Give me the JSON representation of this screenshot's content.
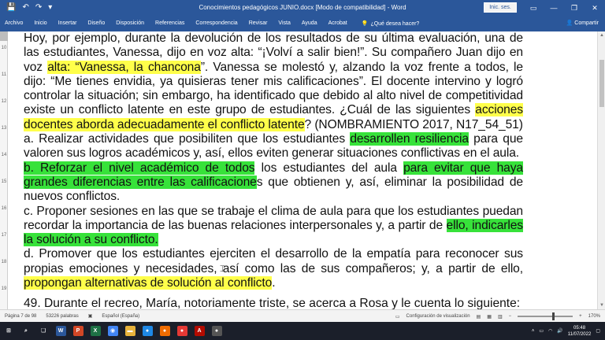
{
  "window": {
    "title": "Conocimientos pedagógicos JUNIO.docx [Modo de compatibilidad]  -  Word",
    "signin_label": "Inic. ses.",
    "minimize_icon": "—",
    "restore_icon": "❐",
    "close_icon": "✕",
    "ribbon_display_icon": "▭"
  },
  "qat": {
    "save_icon": "💾",
    "undo_icon": "↶",
    "redo_icon": "↷",
    "more_icon": "▾"
  },
  "ribbon": {
    "tabs": [
      "Archivo",
      "Inicio",
      "Insertar",
      "Diseño",
      "Disposición",
      "Referencias",
      "Correspondencia",
      "Revisar",
      "Vista",
      "Ayuda",
      "Acrobat"
    ],
    "search_icon": "💡",
    "search_placeholder": "¿Qué desea hacer?",
    "share_label": "Compartir",
    "share_icon": "👤"
  },
  "ruler": {
    "numbers": [
      "10",
      "11",
      "12",
      "13",
      "14",
      "15",
      "16",
      "17",
      "18",
      "19"
    ]
  },
  "document": {
    "p1": [
      {
        "t": "Hoy, por ejemplo, durante la devolución de los resultados de su última evaluación, una de las estudiantes, Vanessa, dijo en voz alta: “¡Volví a salir bien!”. Su compañero Juan dijo en voz ",
        "h": ""
      },
      {
        "t": "alta: “Vanessa, la chancona",
        "h": "y"
      },
      {
        "t": "”. Vanessa se molestó y, alzando la voz frente a todos, le dijo: “Me tienes envidia, ya quisieras tener mis calificaciones”. El docente intervino y logró controlar la situación; sin embargo, ha identificado que debido al alto nivel de competitividad existe un conflicto latente en este grupo de estudiantes. ¿Cuál de las siguientes ",
        "h": ""
      },
      {
        "t": "acciones docentes aborda adecuadamente el conflicto latente",
        "h": "y"
      },
      {
        "t": "? (NOMBRAMIENTO 2017, N17_54_51)",
        "h": ""
      }
    ],
    "pa": [
      {
        "t": "a. Realizar actividades que posibiliten que los estudiantes ",
        "h": ""
      },
      {
        "t": "desarrollen resiliencia",
        "h": "g"
      },
      {
        "t": " para que valoren sus logros académicos y, así, ellos eviten generar situaciones conflictivas en el aula.",
        "h": ""
      }
    ],
    "pb": [
      {
        "t": "b. Reforzar el nivel académico de todos",
        "h": "g"
      },
      {
        "t": " los estudiantes del aula ",
        "h": ""
      },
      {
        "t": "para evitar que haya grandes diferencias entre las calificacione",
        "h": "g"
      },
      {
        "t": "s que obtienen y, así, eliminar la posibilidad de nuevos conflictos.",
        "h": ""
      }
    ],
    "pc": [
      {
        "t": "c. Proponer sesiones en las que se trabaje el clima de aula para que los estudiantes puedan recordar la importancia de las buenas relaciones interpersonales y, a partir de ",
        "h": ""
      },
      {
        "t": "ello, indicarles la solución a su conflicto.",
        "h": "g"
      }
    ],
    "pd": [
      {
        "t": "d. Promover que los estudiantes ejerciten el desarrollo de la empatía para reconocer sus propias emociones y necesidades, así como las de sus compañeros; y, a partir de ello, ",
        "h": ""
      },
      {
        "t": "propongan alternativas de solución al conflicto",
        "h": "y"
      },
      {
        "t": ".",
        "h": ""
      }
    ],
    "next_question": "49. Durante el recreo, María, notoriamente triste, se acerca a Rosa y le cuenta lo siguiente:"
  },
  "status": {
    "page": "Página 7 de 98",
    "words": "53226 palabras",
    "language": "Español (España)",
    "display_settings": "Configuración de visualización",
    "zoom": "170%"
  },
  "taskbar": {
    "apps": [
      {
        "name": "start",
        "glyph": "⊞",
        "color": "transparent"
      },
      {
        "name": "search",
        "glyph": "⌕",
        "color": "transparent"
      },
      {
        "name": "taskview",
        "glyph": "❏",
        "color": "transparent"
      },
      {
        "name": "word",
        "glyph": "W",
        "color": "#2b579a"
      },
      {
        "name": "powerpoint",
        "glyph": "P",
        "color": "#d24726"
      },
      {
        "name": "excel",
        "glyph": "X",
        "color": "#1e7145"
      },
      {
        "name": "chrome",
        "glyph": "◉",
        "color": "#4285f4"
      },
      {
        "name": "explorer",
        "glyph": "▬",
        "color": "#e8b33c"
      },
      {
        "name": "app-blue",
        "glyph": "●",
        "color": "#1e88e5"
      },
      {
        "name": "app-orange",
        "glyph": "●",
        "color": "#ef6c00"
      },
      {
        "name": "app-red",
        "glyph": "●",
        "color": "#e53935"
      },
      {
        "name": "acrobat",
        "glyph": "A",
        "color": "#b30b00"
      },
      {
        "name": "app-dark",
        "glyph": "●",
        "color": "#555555"
      }
    ],
    "time": "05:48",
    "date": "11/07/2022"
  }
}
